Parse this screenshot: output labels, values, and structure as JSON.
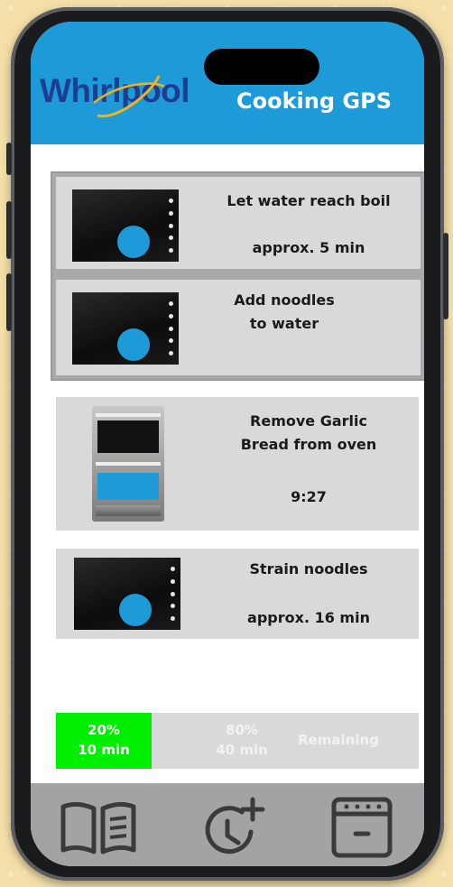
{
  "header": {
    "brand": "Whirlpool",
    "title": "Cooking GPS"
  },
  "steps": [
    {
      "title": "Let water reach boil",
      "detail": "approx. 5 min",
      "appliance": "cooktop"
    },
    {
      "title": "Add noodles to water",
      "detail": "",
      "appliance": "cooktop"
    },
    {
      "title_line1": "Remove Garlic",
      "title_line2": "Bread from oven",
      "detail": "9:27",
      "appliance": "wall-oven"
    },
    {
      "title": "Strain noodles",
      "detail": "approx. 16 min",
      "appliance": "cooktop"
    }
  ],
  "progress": {
    "done_percent": "20%",
    "done_time": "10 min",
    "remaining_percent": "80%",
    "remaining_time": "40 min",
    "remaining_label": "Remaining",
    "fraction": 0.2,
    "done_color": "#00ee00"
  },
  "nav": {
    "icons": [
      "book-icon",
      "add-timer-icon",
      "oven-icon"
    ]
  },
  "colors": {
    "accent": "#1e9ad8",
    "card": "#d9d9d9",
    "nav_bar": "#a3a3a3"
  }
}
